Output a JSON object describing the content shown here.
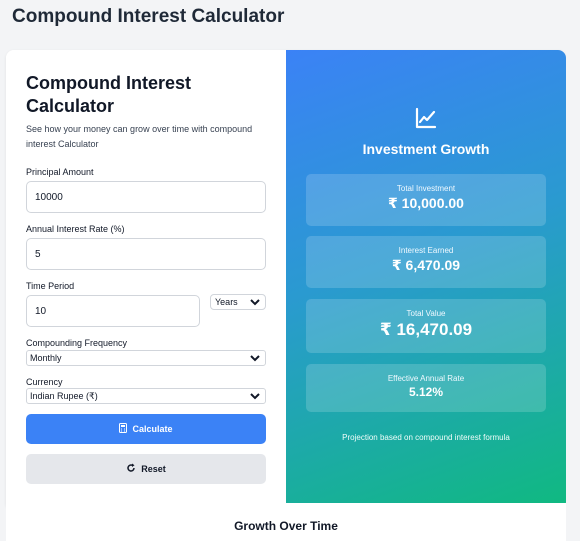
{
  "page": {
    "title": "Compound Interest Calculator"
  },
  "form": {
    "title": "Compound Interest Calculator",
    "subtitle": "See how your money can grow over time with compound interest Calculator",
    "principal": {
      "label": "Principal Amount",
      "value": "10000"
    },
    "rate": {
      "label": "Annual Interest Rate (%)",
      "value": "5"
    },
    "period": {
      "label": "Time Period",
      "value": "10",
      "unit": "Years"
    },
    "frequency": {
      "label": "Compounding Frequency",
      "value": "Monthly"
    },
    "currency": {
      "label": "Currency",
      "value": "Indian Rupee (₹)"
    },
    "calculate_label": "Calculate",
    "reset_label": "Reset"
  },
  "results": {
    "title": "Investment Growth",
    "total_investment": {
      "label": "Total Investment",
      "value": "₹ 10,000.00"
    },
    "interest_earned": {
      "label": "Interest Earned",
      "value": "₹ 6,470.09"
    },
    "total_value": {
      "label": "Total Value",
      "value": "₹ 16,470.09"
    },
    "effective_rate": {
      "label": "Effective Annual Rate",
      "value": "5.12%"
    },
    "note": "Projection based on compound interest formula"
  },
  "growth_section": {
    "title": "Growth Over Time"
  },
  "colors": {
    "primary": "#3b82f6",
    "gradient_start": "#3b82f6",
    "gradient_end": "#10b981",
    "reset_bg": "#e5e7eb"
  },
  "icons": {
    "chart": "chart-line-icon",
    "calculator": "calculator-icon",
    "reset": "redo-icon",
    "dropdown": "chevron-down-icon"
  }
}
